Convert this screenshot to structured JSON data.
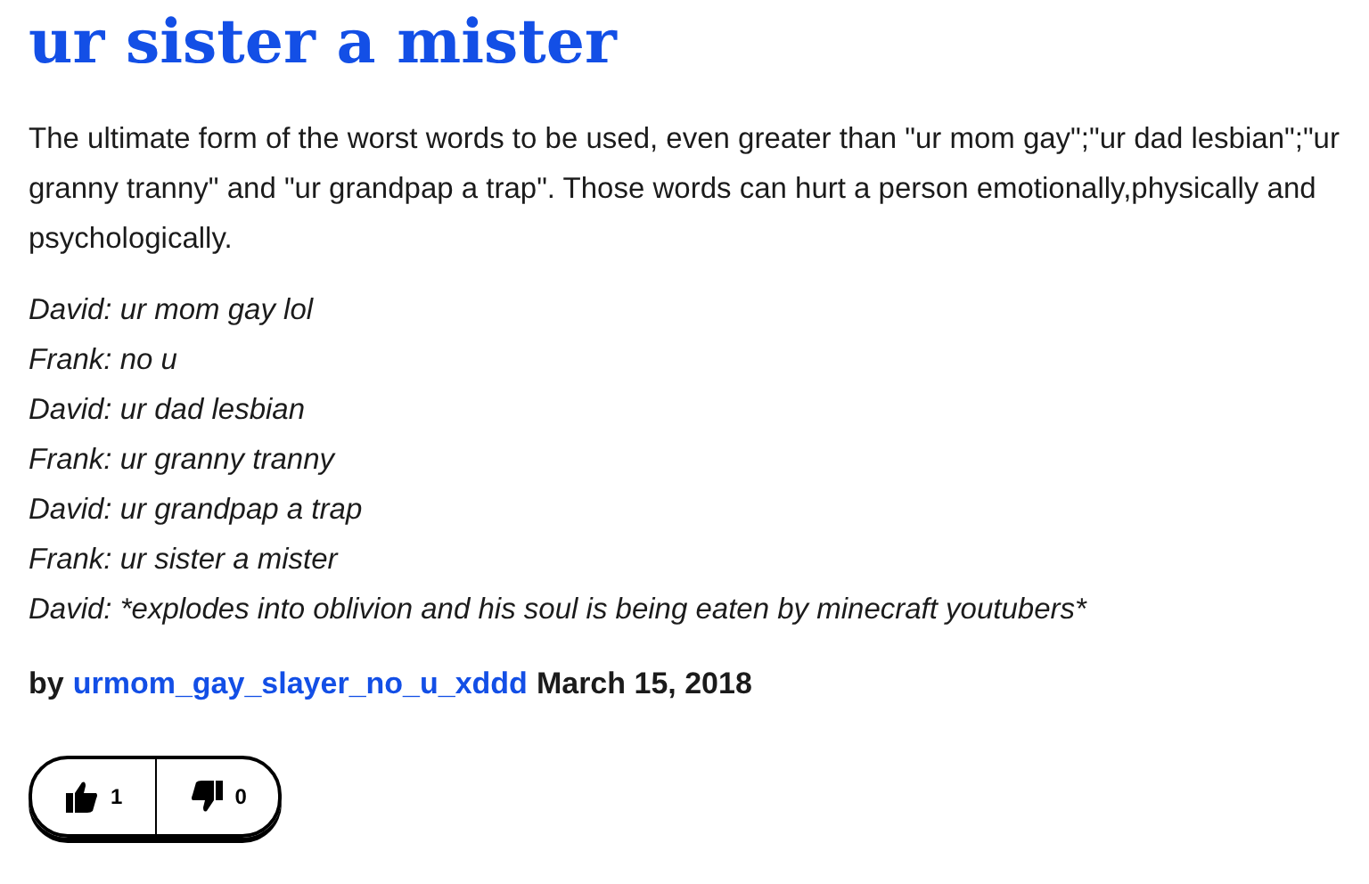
{
  "title": "ur sister a mister",
  "meaning": "The ultimate form of the worst words to be used, even greater than \"ur mom gay\";\"ur dad lesbian\";\"ur granny tranny\" and \"ur grandpap a trap\". Those words can hurt a person emotionally,physically and psychologically.",
  "example": [
    "David: ur mom gay lol",
    "Frank: no u",
    "David: ur dad lesbian",
    "Frank: ur granny tranny",
    "David: ur grandpap a trap",
    "Frank: ur sister a mister",
    "David: *explodes into oblivion and his soul is being eaten by minecraft youtubers*"
  ],
  "contributor": {
    "prefix": "by",
    "author": "urmom_gay_slayer_no_u_xddd",
    "date": "March 15, 2018"
  },
  "votes": {
    "up": "1",
    "down": "0"
  }
}
